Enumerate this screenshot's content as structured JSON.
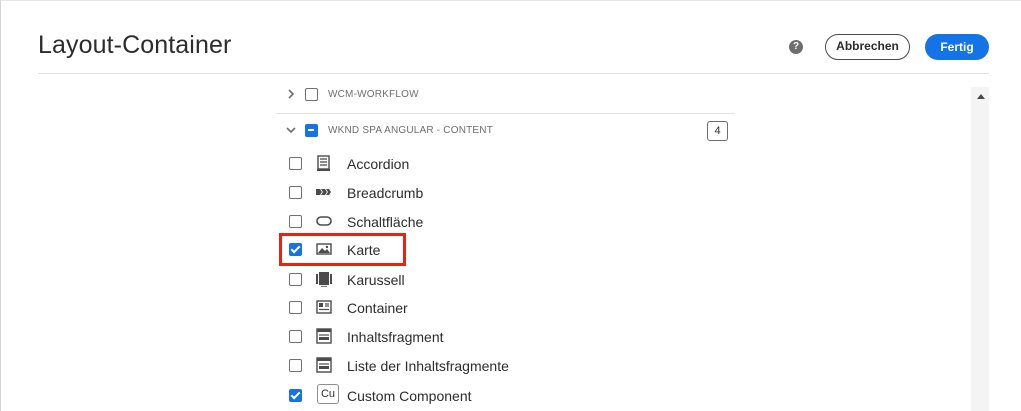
{
  "header": {
    "title": "Layout-Container",
    "help_icon": "help-icon",
    "cancel_label": "Abbrechen",
    "done_label": "Fertig",
    "accent_color": "#1473e6"
  },
  "groups": [
    {
      "label": "WCM-WORKFLOW",
      "expanded": false,
      "state": "unchecked"
    },
    {
      "label": "WKND SPA ANGULAR - CONTENT",
      "expanded": true,
      "state": "partial",
      "count": "4"
    }
  ],
  "components": [
    {
      "label": "Accordion",
      "checked": false,
      "icon": "accordion-icon"
    },
    {
      "label": "Breadcrumb",
      "checked": false,
      "icon": "breadcrumb-icon"
    },
    {
      "label": "Schaltfläche",
      "checked": false,
      "icon": "button-icon"
    },
    {
      "label": "Karte",
      "checked": true,
      "icon": "image-icon",
      "highlighted": true
    },
    {
      "label": "Karussell",
      "checked": false,
      "icon": "carousel-icon"
    },
    {
      "label": "Container",
      "checked": false,
      "icon": "container-icon"
    },
    {
      "label": "Inhaltsfragment",
      "checked": false,
      "icon": "content-fragment-icon"
    },
    {
      "label": "Liste der Inhaltsfragmente",
      "checked": false,
      "icon": "content-fragment-list-icon"
    },
    {
      "label": "Custom Component",
      "checked": true,
      "icon_text": "Cu"
    }
  ],
  "highlight_color": "#e8230f"
}
